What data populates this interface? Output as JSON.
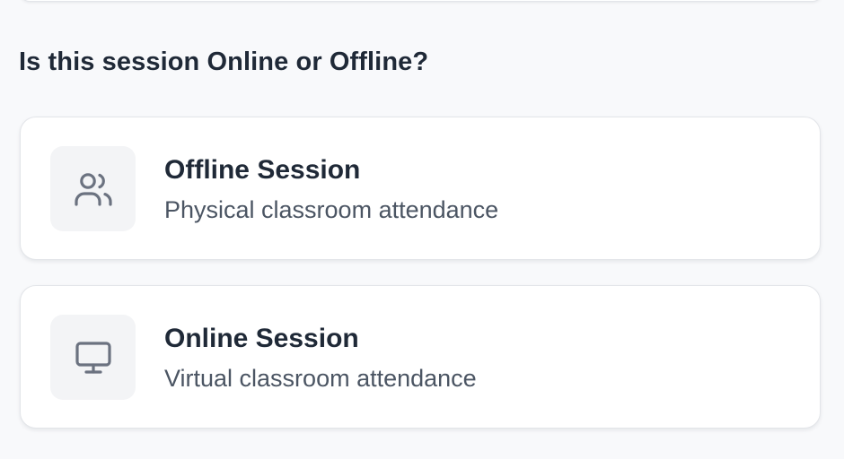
{
  "question": "Is this session Online or Offline?",
  "options": [
    {
      "title": "Offline Session",
      "subtitle": "Physical classroom attendance",
      "icon": "users-icon"
    },
    {
      "title": "Online Session",
      "subtitle": "Virtual classroom attendance",
      "icon": "monitor-icon"
    }
  ],
  "colors": {
    "background": "#f8f9fb",
    "card": "#ffffff",
    "icon_bg": "#f3f4f6",
    "icon": "#6b7280",
    "title": "#1f2937",
    "subtitle": "#4b5563"
  }
}
